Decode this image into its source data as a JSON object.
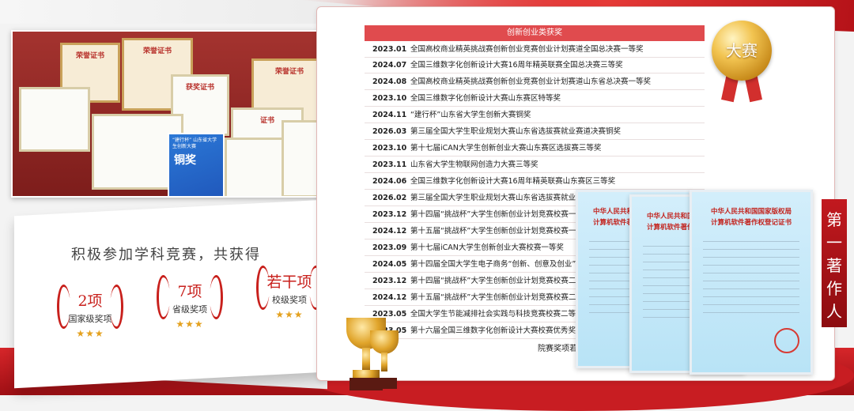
{
  "table": {
    "header": "创新创业类获奖",
    "rows": [
      {
        "date": "2023.01",
        "text": "全国高校商业精英挑战赛创新创业竞赛创业计划赛道全国总决赛一等奖"
      },
      {
        "date": "2024.07",
        "text": "全国三维数字化创新设计大赛16周年精英联赛全国总决赛三等奖"
      },
      {
        "date": "2024.08",
        "text": "全国高校商业精英挑战赛创新创业竞赛创业计划赛道山东省总决赛一等奖"
      },
      {
        "date": "2023.10",
        "text": "全国三维数字化创新设计大赛山东赛区特等奖"
      },
      {
        "date": "2024.11",
        "text": "“建行杯”山东省大学生创新大赛铜奖"
      },
      {
        "date": "2026.03",
        "text": "第三届全国大学生职业规划大赛山东省选拔赛就业赛道决赛铜奖"
      },
      {
        "date": "2023.10",
        "text": "第十七届iCAN大学生创新创业大赛山东赛区选拔赛三等奖"
      },
      {
        "date": "2023.11",
        "text": "山东省大学生物联网创造力大赛三等奖"
      },
      {
        "date": "2024.06",
        "text": "全国三维数字化创新设计大赛16周年精英联赛山东赛区三等奖"
      },
      {
        "date": "2026.02",
        "text": "第三届全国大学生职业规划大赛山东省选拔赛就业赛道校"
      },
      {
        "date": "2023.12",
        "text": "第十四届“挑战杯”大学生创新创业计划竞赛校赛一等奖"
      },
      {
        "date": "2024.12",
        "text": "第十五届“挑战杯”大学生创新创业计划竞赛校赛一等奖"
      },
      {
        "date": "2023.09",
        "text": "第十七届iCAN大学生创新创业大赛校赛一等奖"
      },
      {
        "date": "2024.05",
        "text": "第十四届全国大学生电子商务“创新、创意及创业”挑战"
      },
      {
        "date": "2023.12",
        "text": "第十四届“挑战杯”大学生创新创业计划竞赛校赛二等奖"
      },
      {
        "date": "2024.12",
        "text": "第十五届“挑战杯”大学生创新创业计划竞赛校赛二等奖"
      },
      {
        "date": "2023.05",
        "text": "全国大学生节能减排社会实践与科技竞赛校赛二等奖"
      },
      {
        "date": "2023.05",
        "text": "第十六届全国三维数字化创新设计大赛校赛优秀奖"
      }
    ],
    "summary": "院赛奖项若干"
  },
  "medal_label": "大赛",
  "banner_text": "第一著作人",
  "info": {
    "title": "积极参加学科竞赛，共获得",
    "badges": [
      {
        "count": "2项",
        "label": "国家级奖项",
        "stars": "★★★"
      },
      {
        "count": "7项",
        "label": "省级奖项",
        "stars": "★★★"
      },
      {
        "count": "若干项",
        "label": "校级奖项",
        "stars": "★★★"
      }
    ]
  },
  "photo": {
    "cert_titles": [
      "荣誉证书",
      "荣誉证书",
      "获奖证书",
      "证书"
    ],
    "blue_cert_label": "铜奖",
    "blue_cert_caption": "“建行杯” 山东省大学生创新大赛"
  },
  "software_certs": {
    "title_line1": "中华人民共和国国家版权局",
    "title_line2": "计算机软件著作权登记证书"
  },
  "colors": {
    "accent_red": "#e04b4e",
    "gold": "#e0a42a",
    "stage_red": "#c81d22"
  }
}
